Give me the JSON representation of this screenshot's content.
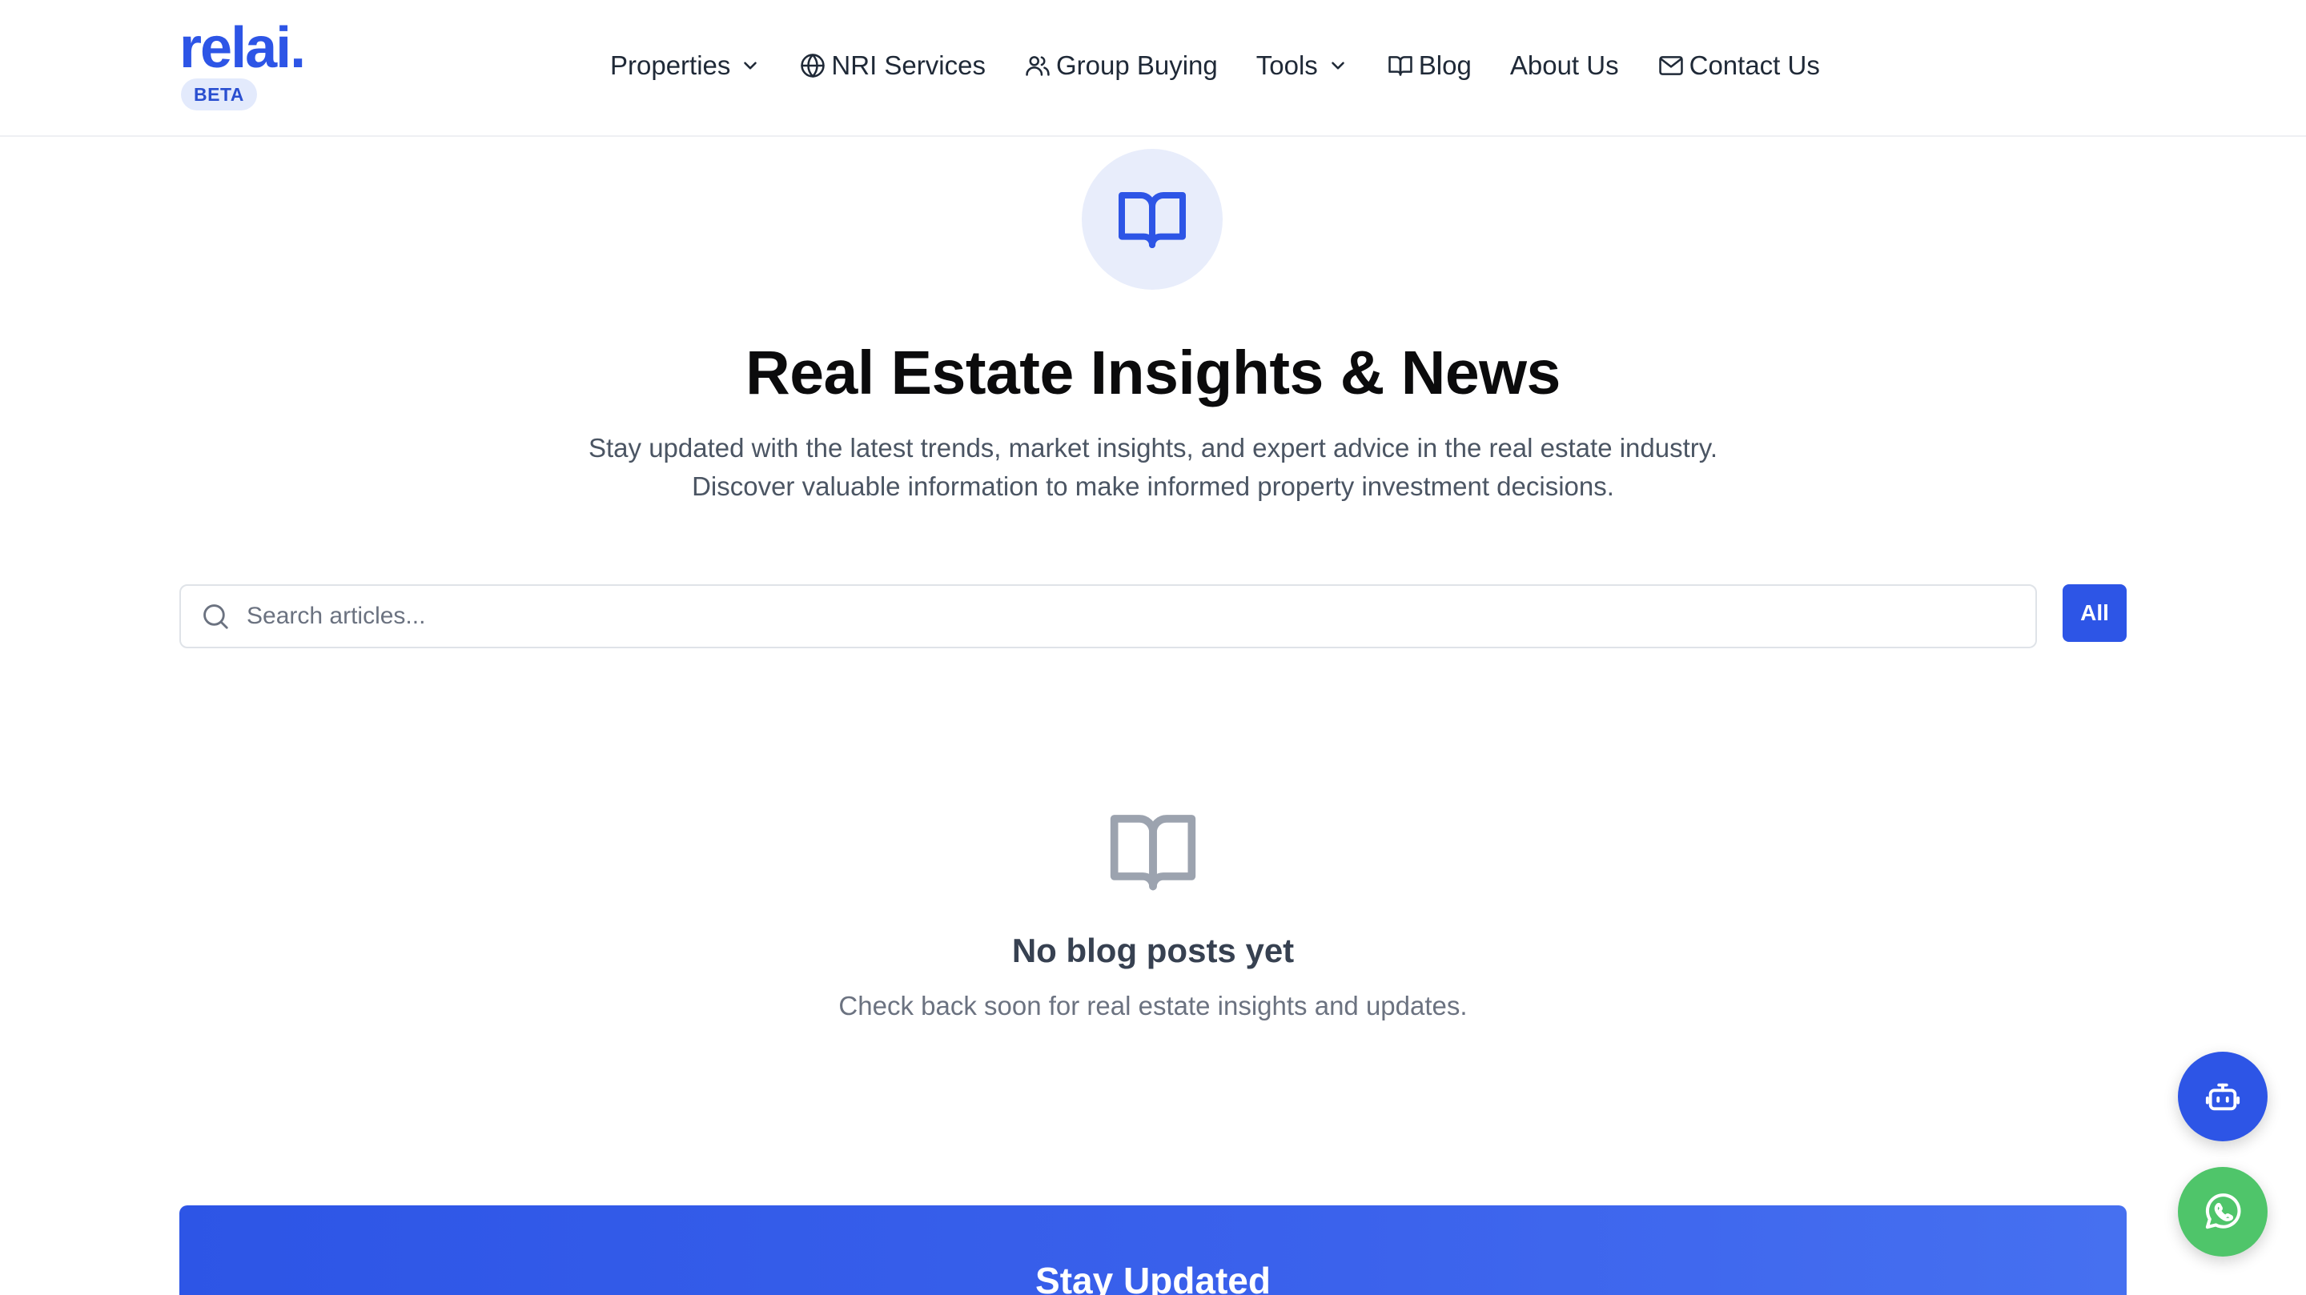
{
  "brand": {
    "logo_text": "relai.",
    "badge": "BETA",
    "accent_color": "#2d55e6"
  },
  "nav": {
    "items": [
      {
        "label": "Properties",
        "icon": "",
        "has_dropdown": true
      },
      {
        "label": "NRI Services",
        "icon": "globe-icon",
        "has_dropdown": false
      },
      {
        "label": "Group Buying",
        "icon": "users-icon",
        "has_dropdown": false
      },
      {
        "label": "Tools",
        "icon": "",
        "has_dropdown": true
      },
      {
        "label": "Blog",
        "icon": "book-icon",
        "has_dropdown": false
      },
      {
        "label": "About Us",
        "icon": "",
        "has_dropdown": false
      },
      {
        "label": "Contact Us",
        "icon": "mail-icon",
        "has_dropdown": false
      }
    ]
  },
  "hero": {
    "icon": "book-open-icon",
    "title": "Real Estate Insights & News",
    "subtitle_line1": "Stay updated with the latest trends, market insights, and expert advice in the real estate industry.",
    "subtitle_line2": "Discover valuable information to make informed property investment decisions."
  },
  "search": {
    "placeholder": "Search articles...",
    "value": "",
    "filter_label": "All"
  },
  "empty_state": {
    "icon": "book-open-icon",
    "title": "No blog posts yet",
    "message": "Check back soon for real estate insights and updates."
  },
  "floating": {
    "assistant_icon": "bot-icon",
    "chat_icon": "whatsapp-icon",
    "whatsapp_color": "#4fc56a"
  },
  "newsletter": {
    "title": "Stay Updated"
  }
}
